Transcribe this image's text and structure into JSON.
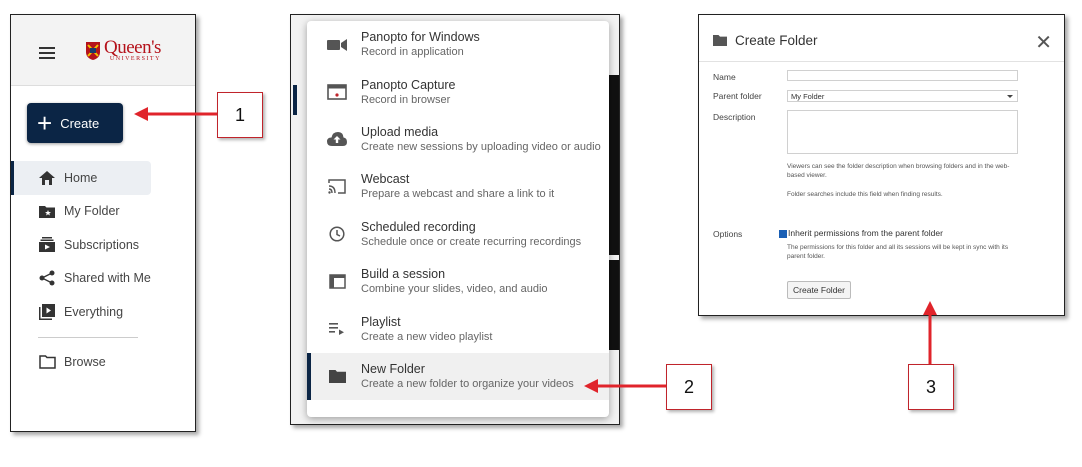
{
  "panel1": {
    "logo": {
      "name": "Queen's",
      "sub": "UNIVERSITY"
    },
    "create_label": "Create",
    "nav": [
      {
        "label": "Home",
        "icon": "home-icon"
      },
      {
        "label": "My Folder",
        "icon": "folder-star-icon"
      },
      {
        "label": "Subscriptions",
        "icon": "subscriptions-icon"
      },
      {
        "label": "Shared with Me",
        "icon": "share-icon"
      },
      {
        "label": "Everything",
        "icon": "play-library-icon"
      },
      {
        "label": "Browse",
        "icon": "folder-outline-icon"
      }
    ]
  },
  "panel2": {
    "items": [
      {
        "title": "Panopto for Windows",
        "desc": "Record in application",
        "icon": "camera-icon"
      },
      {
        "title": "Panopto Capture",
        "desc": "Record in browser",
        "icon": "browser-record-icon"
      },
      {
        "title": "Upload media",
        "desc": "Create new sessions by uploading video or audio",
        "icon": "cloud-upload-icon"
      },
      {
        "title": "Webcast",
        "desc": "Prepare a webcast and share a link to it",
        "icon": "cast-icon"
      },
      {
        "title": "Scheduled recording",
        "desc": "Schedule once or create recurring recordings",
        "icon": "clock-icon"
      },
      {
        "title": "Build a session",
        "desc": "Combine your slides, video, and audio",
        "icon": "window-icon"
      },
      {
        "title": "Playlist",
        "desc": "Create a new video playlist",
        "icon": "playlist-icon"
      },
      {
        "title": "New Folder",
        "desc": "Create a new folder to organize your videos",
        "icon": "folder-icon"
      }
    ]
  },
  "panel3": {
    "title": "Create Folder",
    "name_label": "Name",
    "parent_label": "Parent folder",
    "parent_value": "My Folder",
    "description_label": "Description",
    "hint1": "Viewers can see the folder description when browsing folders and in the web-based viewer.",
    "hint2": "Folder searches include this field when finding results.",
    "options_label": "Options",
    "inherit_label": "Inherit permissions from the parent folder",
    "inherit_hint": "The permissions for this folder and all its sessions will be kept in sync with its parent folder.",
    "inherit_checked": true,
    "button_label": "Create Folder"
  },
  "callouts": [
    "1",
    "2",
    "3"
  ],
  "colors": {
    "brand_navy": "#0b2545",
    "queens_red": "#b5121b",
    "arrow_red": "#e0242b"
  }
}
